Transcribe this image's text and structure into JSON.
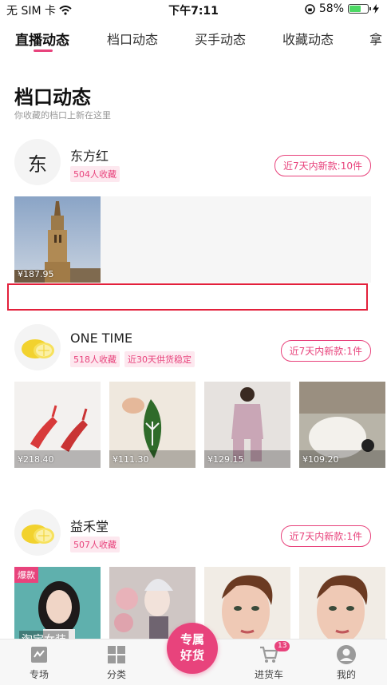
{
  "status_bar": {
    "carrier": "无 SIM 卡",
    "time": "下午7:11",
    "battery_pct": "58%",
    "battery_level": 0.58
  },
  "tabs": [
    "直播动态",
    "档口动态",
    "买手动态",
    "收藏动态",
    "拿"
  ],
  "page": {
    "title": "档口动态",
    "subtitle": "你收藏的档口上新在这里"
  },
  "shops": [
    {
      "name": "东方红",
      "avatar_text": "东",
      "tags": [
        "504人收藏"
      ],
      "new_label": "近7天内新款:10件",
      "products": [
        {
          "price": "¥187.95",
          "image": "church-tower"
        }
      ]
    },
    {
      "name": "ONE TIME",
      "avatar_text": "",
      "avatar_image": "lemon",
      "tags": [
        "518人收藏",
        "近30天供货稳定"
      ],
      "new_label": "近7天内新款:1件",
      "products": [
        {
          "price": "¥218.40",
          "image": "red-sandals"
        },
        {
          "price": "¥111.30",
          "image": "leaf-keychain"
        },
        {
          "price": "¥129.15",
          "image": "knit-dress"
        },
        {
          "price": "¥109.20",
          "image": "fluffy-pillow"
        }
      ]
    },
    {
      "name": "益禾堂",
      "avatar_text": "",
      "avatar_image": "lemon",
      "tags": [
        "507人收藏"
      ],
      "new_label": "近7天内新款:1件",
      "products": [
        {
          "badge": "爆款",
          "caption": "淘宝女装",
          "image": "woman-portrait"
        },
        {
          "image": "fantasy-painting"
        },
        {
          "image": "face-painting"
        },
        {
          "image": "face-painting"
        }
      ]
    }
  ],
  "bottom_nav": {
    "items": [
      {
        "label": "专场",
        "icon": "live-icon"
      },
      {
        "label": "分类",
        "icon": "grid-icon"
      },
      {
        "label": "进货车",
        "icon": "cart-icon",
        "badge": "13"
      },
      {
        "label": "我的",
        "icon": "user-icon"
      }
    ],
    "center": {
      "line1": "专属",
      "line2": "好货"
    }
  },
  "colors": {
    "accent": "#e8437c",
    "highlight_box": "#e3203b"
  }
}
